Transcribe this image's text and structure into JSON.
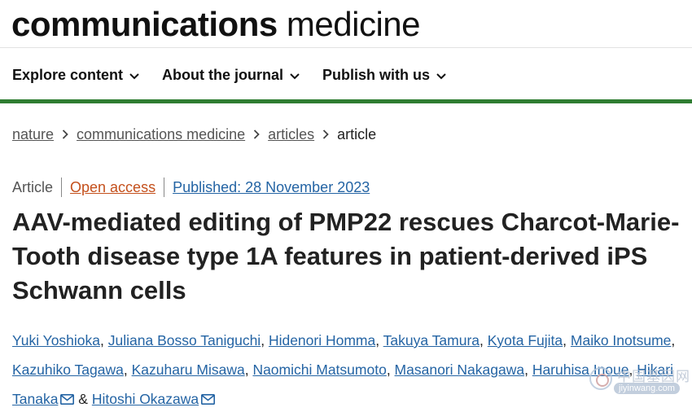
{
  "brand": {
    "bold": "communications",
    "light": "medicine"
  },
  "nav": {
    "items": [
      {
        "label": "Explore content"
      },
      {
        "label": "About the journal"
      },
      {
        "label": "Publish with us"
      }
    ]
  },
  "breadcrumb": {
    "items": [
      "nature",
      "communications medicine",
      "articles"
    ],
    "current": "article"
  },
  "meta": {
    "type": "Article",
    "open_access": "Open access",
    "published": "Published: 28 November 2023"
  },
  "title": "AAV-mediated editing of PMP22 rescues Charcot-Marie-Tooth disease type 1A features in patient-derived iPS Schwann cells",
  "authors": [
    "Yuki Yoshioka",
    "Juliana Bosso Taniguchi",
    "Hidenori Homma",
    "Takuya Tamura",
    "Kyota Fujita",
    "Maiko Inotsume",
    "Kazuhiko Tagawa",
    "Kazuharu Misawa",
    "Naomichi Matsumoto",
    "Masanori Nakagawa",
    "Haruhisa Inoue",
    "Hikari Tanaka",
    "Hitoshi Okazawa"
  ],
  "author_separators": {
    "comma": ", ",
    "and": " & "
  },
  "watermark": {
    "cn": "中国基因网",
    "url": "jiyinwang.com"
  },
  "colors": {
    "accent_green": "#2f7d32",
    "link_blue": "#2464a4",
    "open_access_orange": "#c4501c"
  }
}
